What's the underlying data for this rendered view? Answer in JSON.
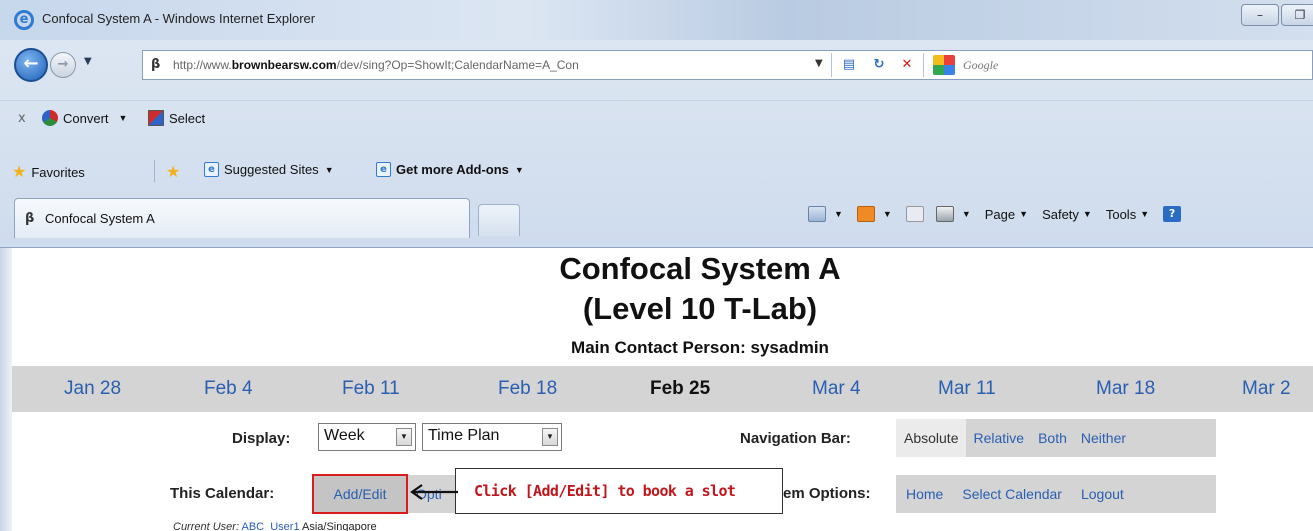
{
  "browser": {
    "window_title": "Confocal System A - Windows Internet Explorer",
    "window_controls": [
      "–",
      "❐"
    ],
    "address_url_prefix": "http://www.",
    "address_url_domain": "brownbearsw.com",
    "address_url_suffix": "/dev/sing?Op=ShowIt;CalendarName=A_Con",
    "search_placeholder": "Google",
    "command_bar": {
      "close_glyph": "x",
      "convert_label": "Convert",
      "select_label": "Select"
    },
    "favorites_bar": {
      "favorites_label": "Favorites",
      "suggested_sites_label": "Suggested Sites",
      "addons_label": "Get more Add-ons"
    },
    "tab_title": "Confocal System A",
    "tools_menu": {
      "page_label": "Page",
      "safety_label": "Safety",
      "tools_label": "Tools"
    },
    "icons": {
      "accent_blue": "#2a6bc4",
      "stop_red": "#d21c1c",
      "favorites_star": "#f2b01b"
    }
  },
  "page": {
    "calendar_title": "Confocal System A",
    "calendar_subtitle": "(Level 10 T-Lab)",
    "contact_line": "Main Contact Person: sysadmin",
    "weeks": [
      {
        "label": "Jan 28",
        "current": false
      },
      {
        "label": "Feb 4",
        "current": false
      },
      {
        "label": "Feb 11",
        "current": false
      },
      {
        "label": "Feb 18",
        "current": false
      },
      {
        "label": "Feb 25",
        "current": true
      },
      {
        "label": "Mar 4",
        "current": false
      },
      {
        "label": "Mar 11",
        "current": false
      },
      {
        "label": "Mar 18",
        "current": false
      },
      {
        "label": "Mar 2",
        "current": false
      }
    ],
    "display": {
      "label": "Display:",
      "view_value": "Week",
      "plan_value": "Time Plan"
    },
    "navigation_bar": {
      "label": "Navigation Bar:",
      "options": [
        "Absolute",
        "Relative",
        "Both",
        "Neither"
      ],
      "selected": "Absolute"
    },
    "this_calendar": {
      "label": "This Calendar:",
      "add_edit_label": "Add/Edit",
      "options_partial": "Opti"
    },
    "system_options": {
      "label_partial": "em Options:",
      "options": [
        "Home",
        "Select Calendar",
        "Logout"
      ]
    },
    "callout_text": "Click [Add/Edit] to book a slot",
    "current_user": {
      "label": "Current User:",
      "user": "ABC_User1",
      "timezone": "Asia/Singapore"
    },
    "colors": {
      "link_blue": "#2a5eb0",
      "highlight_red": "#d81c1c",
      "bar_gray": "#d4d4d4"
    }
  }
}
